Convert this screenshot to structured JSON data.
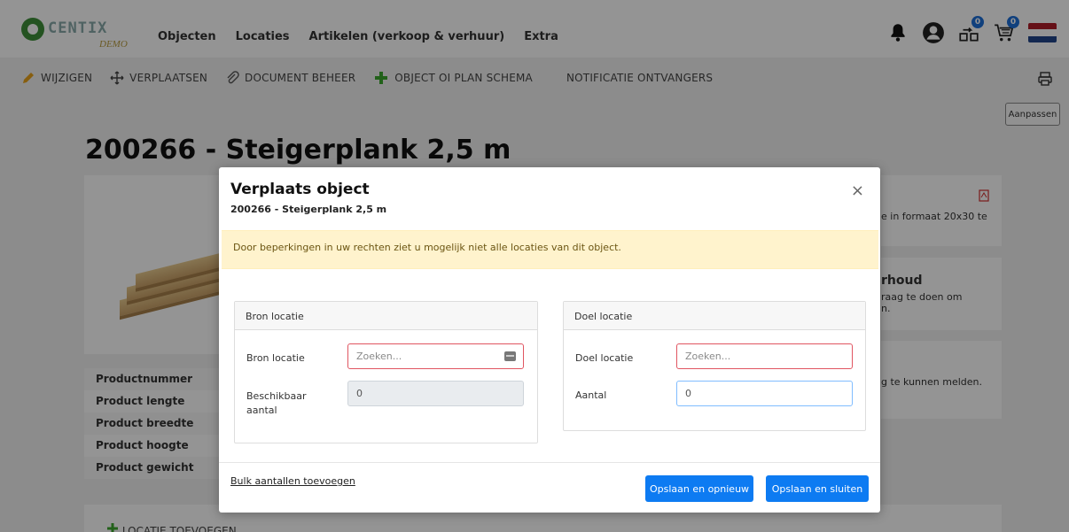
{
  "brand": {
    "name": "CENTIX",
    "sub": "DEMO"
  },
  "nav": [
    "Objecten",
    "Locaties",
    "Artikelen (verkoop & verhuur)",
    "Extra"
  ],
  "badges": {
    "transfer": "0",
    "cart": "0"
  },
  "colors": {
    "primary": "#0d7bf2",
    "alert_bg": "#fff3cd",
    "error": "#e05561",
    "plus_green": "#3ba82e",
    "edit_orange": "#e8a21b"
  },
  "toolbar": {
    "wijzigen": "WIJZIGEN",
    "verplaatsen": "VERPLAATSEN",
    "document": "DOCUMENT BEHEER",
    "object_plan": "OBJECT OI PLAN SCHEMA",
    "notificatie": "NOTIFICATIE ONTVANGERS"
  },
  "aanpassen": "Aanpassen",
  "page": {
    "title": "200266 - Steigerplank 2,5 m",
    "specs": [
      "Productnummer",
      "Product lengte",
      "Product breedte",
      "Product hoogte",
      "Product gewicht"
    ],
    "right1": "e in formaat 20x30 te",
    "right2_title": "rhoud",
    "right2_a": "raag te doen om",
    "right2_b": "n.",
    "right3": "g te kunnen melden.",
    "locatie_toevoegen": "LOCATIE TOEVOEGEN"
  },
  "modal": {
    "title": "Verplaats object",
    "subtitle": "200266 - Steigerplank 2,5 m",
    "close": "×",
    "alert": "Door beperkingen in uw rechten ziet u mogelijk niet alle locaties van dit object.",
    "bron": {
      "header": "Bron locatie",
      "label": "Bron locatie",
      "placeholder": "Zoeken...",
      "beschikbaar_label": "Beschikbaar aantal",
      "beschikbaar_value": "0"
    },
    "doel": {
      "header": "Doel locatie",
      "label": "Doel locatie",
      "placeholder": "Zoeken...",
      "aantal_label": "Aantal",
      "aantal_value": "0"
    },
    "bulk_link": "Bulk aantallen toevoegen",
    "btn_opnieuw": "Opslaan en opnieuw",
    "btn_sluiten": "Opslaan en sluiten"
  }
}
